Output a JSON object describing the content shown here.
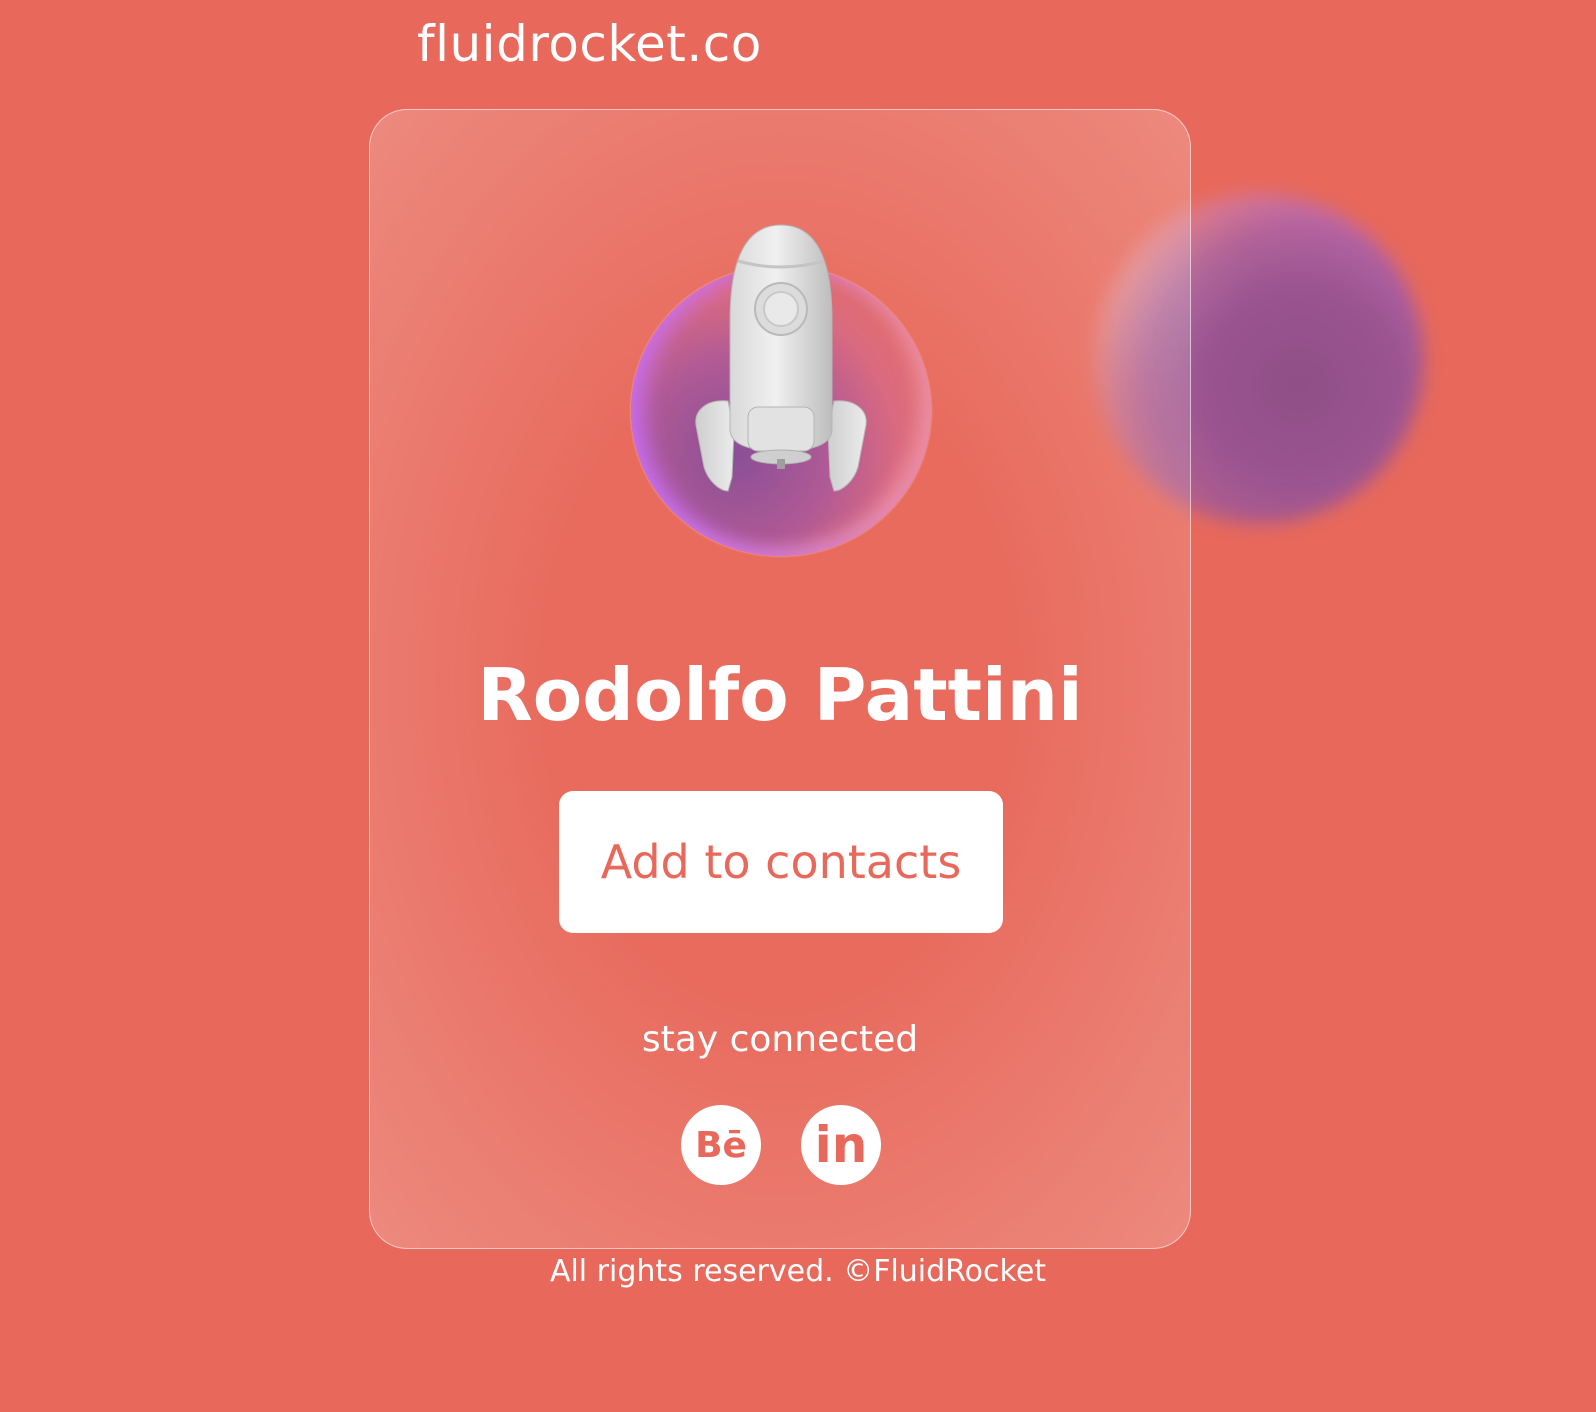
{
  "header": {
    "brand": "fluidrocket.co"
  },
  "card": {
    "name": "Rodolfo Pattini",
    "add_button_label": "Add to contacts",
    "stay_connected": "stay connected",
    "social": [
      {
        "network": "behance",
        "glyph": "Bē",
        "icon": "behance-icon"
      },
      {
        "network": "linkedin",
        "glyph": "in",
        "icon": "linkedin-icon"
      }
    ]
  },
  "footer": {
    "text": "All rights reserved. ©FluidRocket"
  },
  "colors": {
    "background": "#e8695b",
    "button_text": "#e8695b",
    "text": "#ffffff"
  }
}
